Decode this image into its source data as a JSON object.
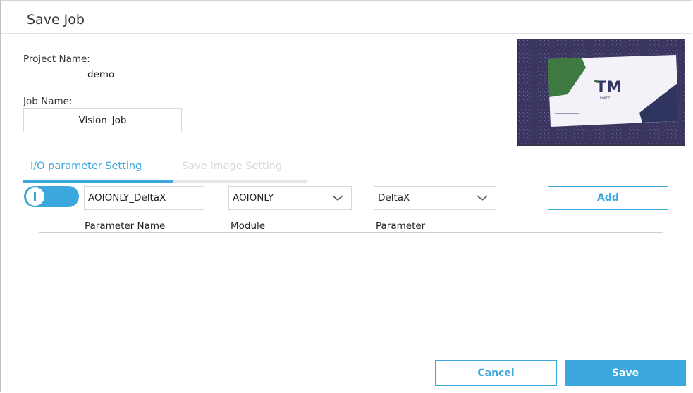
{
  "dialog": {
    "title": "Save Job",
    "project_name_label": "Project Name:",
    "project_name_value": "demo",
    "job_name_label": "Job Name:",
    "job_name_value": "Vision_Job"
  },
  "preview": {
    "logo_text": "TM",
    "logo_subtext": "ROBOT"
  },
  "tabs": [
    {
      "label": "I/O parameter Setting",
      "active": true
    },
    {
      "label": "Save Image Setting",
      "active": false
    }
  ],
  "io_form": {
    "toggle_on": true,
    "parameter_name_value": "AOIONLY_DeltaX",
    "module_selected": "AOIONLY",
    "parameter_selected": "DeltaX",
    "add_label": "Add"
  },
  "table": {
    "columns": [
      "Parameter Name",
      "Module",
      "Parameter"
    ],
    "rows": []
  },
  "footer": {
    "cancel_label": "Cancel",
    "save_label": "Save"
  },
  "colors": {
    "accent": "#3ba7dc",
    "inactive_tab": "#d8d8d8",
    "border": "#d9d9d9"
  }
}
